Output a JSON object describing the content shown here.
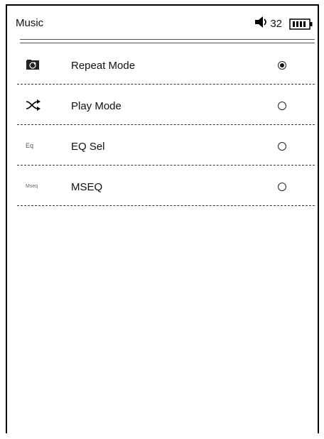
{
  "header": {
    "title": "Music",
    "volume_icon": "speaker-icon",
    "volume_value": "32",
    "battery_icon": "battery-icon"
  },
  "menu": {
    "items": [
      {
        "label": "Repeat Mode",
        "icon": "repeat-icon",
        "selected": true
      },
      {
        "label": "Play Mode",
        "icon": "shuffle-icon",
        "selected": false
      },
      {
        "label": "EQ Sel",
        "icon_text": "Eq",
        "selected": false
      },
      {
        "label": "MSEQ",
        "icon_text": "Mseq",
        "selected": false
      }
    ]
  }
}
